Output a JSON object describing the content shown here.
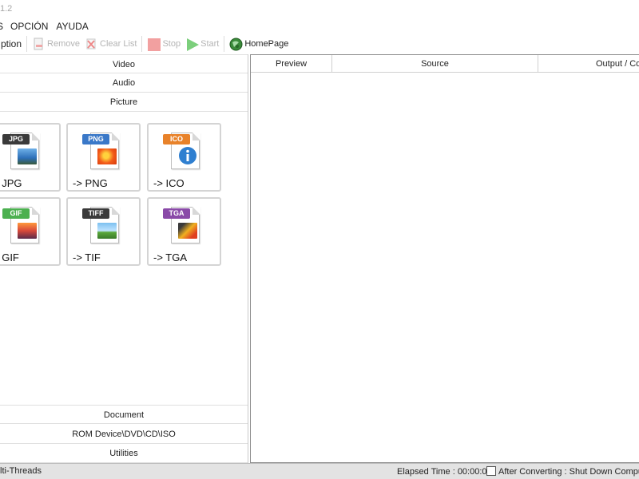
{
  "window": {
    "title_fragment": "1.2"
  },
  "menu": {
    "items": [
      "S",
      "OPCIÓN",
      "AYUDA"
    ]
  },
  "toolbar": {
    "option_label": "ption",
    "remove_label": "Remove",
    "clear_label": "Clear List",
    "stop_label": "Stop",
    "start_label": "Start",
    "homepage_label": "HomePage"
  },
  "categories": {
    "video": "Video",
    "audio": "Audio",
    "picture": "Picture",
    "document": "Document",
    "rom": "ROM Device\\DVD\\CD\\ISO",
    "utilities": "Utilities"
  },
  "formats": [
    {
      "tag": "JPG",
      "label": "> JPG",
      "tag_color": "#3a3a3a"
    },
    {
      "tag": "PNG",
      "label": "-> PNG",
      "tag_color": "#3a78c8"
    },
    {
      "tag": "ICO",
      "label": "-> ICO",
      "tag_color": "#e8822a"
    },
    {
      "tag": "GIF",
      "label": "> GIF",
      "tag_color": "#4cb050"
    },
    {
      "tag": "TIFF",
      "label": "-> TIF",
      "tag_color": "#3a3a3a"
    },
    {
      "tag": "TGA",
      "label": "-> TGA",
      "tag_color": "#8a4aa8"
    }
  ],
  "table": {
    "columns": [
      "Preview",
      "Source",
      "Output / Co"
    ]
  },
  "status": {
    "threads": "lti-Threads",
    "elapsed": "Elapsed Time : 00:00:00",
    "after_converting": "After Converting : Shut Down Compu"
  },
  "colors": {
    "stop_icon": "#f2a0a0",
    "start_icon": "#7ccf7c",
    "status_bg": "#e3e3e3"
  }
}
